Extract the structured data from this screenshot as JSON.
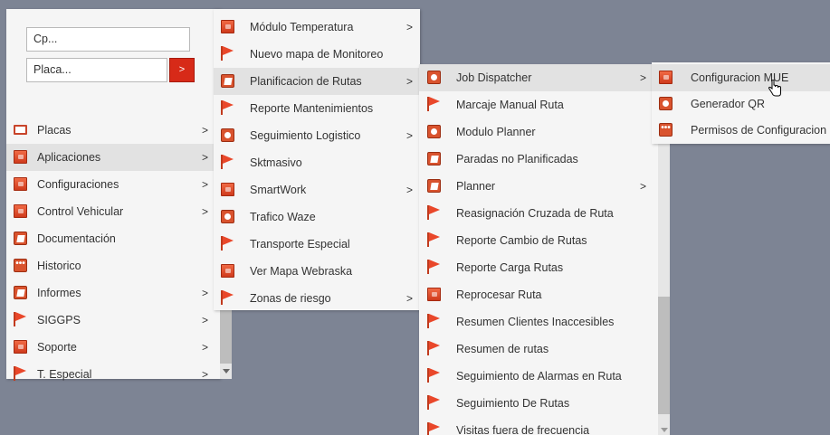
{
  "search": {
    "cp_placeholder": "Cp...",
    "placa_placeholder": "Placa...",
    "go_label": ">"
  },
  "menu1": [
    {
      "label": "Placas",
      "icon": "plate-icon",
      "has_sub": true
    },
    {
      "label": "Aplicaciones",
      "icon": "box-icon",
      "has_sub": true,
      "selected": true
    },
    {
      "label": "Configuraciones",
      "icon": "box-icon",
      "has_sub": true
    },
    {
      "label": "Control Vehicular",
      "icon": "box-icon",
      "has_sub": true
    },
    {
      "label": "Documentación",
      "icon": "document-icon",
      "has_sub": false
    },
    {
      "label": "Historico",
      "icon": "dots-icon",
      "has_sub": false
    },
    {
      "label": "Informes",
      "icon": "document-icon",
      "has_sub": true
    },
    {
      "label": "SIGGPS",
      "icon": "flag-icon",
      "has_sub": true
    },
    {
      "label": "Soporte",
      "icon": "box-icon",
      "has_sub": true
    },
    {
      "label": "T. Especial",
      "icon": "flag-icon",
      "has_sub": true
    }
  ],
  "menu2": [
    {
      "label": "Módulo Temperatura",
      "icon": "box-icon",
      "has_sub": true
    },
    {
      "label": "Nuevo mapa de Monitoreo",
      "icon": "flag-icon",
      "has_sub": false
    },
    {
      "label": "Planificacion de Rutas",
      "icon": "document-icon",
      "has_sub": true,
      "selected": true
    },
    {
      "label": "Reporte Mantenimientos",
      "icon": "flag-icon",
      "has_sub": false
    },
    {
      "label": "Seguimiento Logistico",
      "icon": "gear-icon",
      "has_sub": true
    },
    {
      "label": "Sktmasivo",
      "icon": "flag-icon",
      "has_sub": false
    },
    {
      "label": "SmartWork",
      "icon": "box-icon",
      "has_sub": true
    },
    {
      "label": "Trafico Waze",
      "icon": "gear-icon",
      "has_sub": false
    },
    {
      "label": "Transporte Especial",
      "icon": "flag-icon",
      "has_sub": false
    },
    {
      "label": "Ver Mapa Webraska",
      "icon": "box-icon",
      "has_sub": false
    },
    {
      "label": "Zonas de riesgo",
      "icon": "flag-icon",
      "has_sub": true
    }
  ],
  "menu3": [
    {
      "label": "Job Dispatcher",
      "icon": "gear-icon",
      "has_sub": true,
      "selected": true
    },
    {
      "label": "Marcaje Manual Ruta",
      "icon": "flag-icon",
      "has_sub": false
    },
    {
      "label": "Modulo Planner",
      "icon": "gear-icon",
      "has_sub": false
    },
    {
      "label": "Paradas no Planificadas",
      "icon": "document-icon",
      "has_sub": false
    },
    {
      "label": "Planner",
      "icon": "document-icon",
      "has_sub": true
    },
    {
      "label": "Reasignación Cruzada de Ruta",
      "icon": "flag-icon",
      "has_sub": false
    },
    {
      "label": "Reporte Cambio de Rutas",
      "icon": "flag-icon",
      "has_sub": false
    },
    {
      "label": "Reporte Carga Rutas",
      "icon": "flag-icon",
      "has_sub": false
    },
    {
      "label": "Reprocesar Ruta",
      "icon": "box-icon",
      "has_sub": false
    },
    {
      "label": "Resumen Clientes Inaccesibles",
      "icon": "flag-icon",
      "has_sub": false
    },
    {
      "label": "Resumen de rutas",
      "icon": "flag-icon",
      "has_sub": false
    },
    {
      "label": "Seguimiento de Alarmas en Ruta",
      "icon": "flag-icon",
      "has_sub": false
    },
    {
      "label": "Seguimiento De Rutas",
      "icon": "flag-icon",
      "has_sub": false
    },
    {
      "label": "Visitas fuera de frecuencia",
      "icon": "flag-icon",
      "has_sub": false
    }
  ],
  "menu4": [
    {
      "label": "Configuracion MUE",
      "icon": "box-icon",
      "has_sub": false,
      "selected": true
    },
    {
      "label": "Generador QR",
      "icon": "gear-icon",
      "has_sub": false
    },
    {
      "label": "Permisos de Configuracion",
      "icon": "dots-icon",
      "has_sub": false
    }
  ],
  "colors": {
    "background": "#7d8494",
    "menu_bg": "#f5f5f5",
    "highlight": "#e2e2e2",
    "accent": "#d72a18"
  },
  "arrow_glyph": ">",
  "dots_glyph": "•••"
}
